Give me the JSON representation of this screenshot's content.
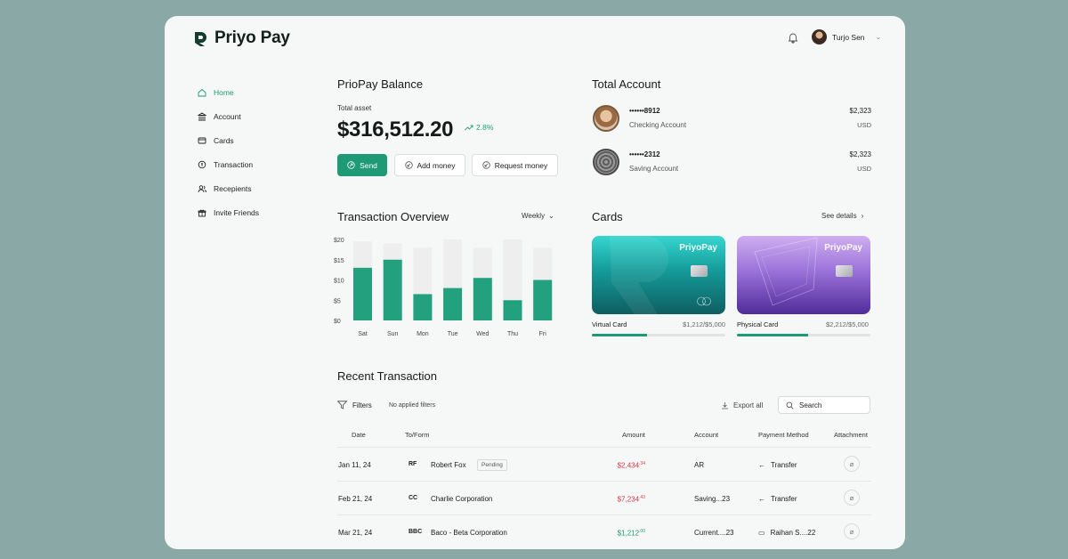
{
  "app": {
    "brand": "Priyo Pay",
    "user_name": "Turjo Sen"
  },
  "sidebar": {
    "items": [
      {
        "label": "Home",
        "icon": "home-icon",
        "active": true
      },
      {
        "label": "Account",
        "icon": "bank-icon"
      },
      {
        "label": "Cards",
        "icon": "card-icon"
      },
      {
        "label": "Transaction",
        "icon": "transaction-icon"
      },
      {
        "label": "Recepients",
        "icon": "recipients-icon"
      },
      {
        "label": "Invite Friends",
        "icon": "gift-icon"
      }
    ]
  },
  "balance": {
    "title": "PrioPay Balance",
    "total_label": "Total asset",
    "amount": "$316,512.20",
    "change": "2.8%",
    "send_label": "Send",
    "add_label": "Add money",
    "request_label": "Request money"
  },
  "accounts": {
    "title": "Total Account",
    "items": [
      {
        "number": "••••••8912",
        "type": "Checking Account",
        "amount": "$2,323",
        "currency": "USD"
      },
      {
        "number": "••••••2312",
        "type": "Saving Account",
        "amount": "$2,323",
        "currency": "USD"
      }
    ]
  },
  "overview": {
    "title": "Transaction Overview",
    "period": "Weekly"
  },
  "chart_data": {
    "type": "bar",
    "categories": [
      "Sat",
      "Sun",
      "Mon",
      "Tue",
      "Wed",
      "Thu",
      "Fri"
    ],
    "series": [
      {
        "values": [
          13,
          15,
          6.5,
          8,
          10.5,
          5,
          10
        ]
      },
      {
        "values": [
          19.5,
          19,
          18,
          20,
          18,
          20,
          18
        ]
      }
    ],
    "ylim": [
      0,
      20
    ],
    "y_ticks": [
      "$0",
      "$5",
      "$10",
      "$15",
      "$20"
    ],
    "colors": {
      "filled": "#23a07e",
      "track": "#eeeeee"
    }
  },
  "cards": {
    "title": "Cards",
    "see_details": "See details",
    "items": [
      {
        "brand": "PriyoPay",
        "label": "Virtual Card",
        "limit": "$1,212/$5,000",
        "progress": 0.41
      },
      {
        "brand": "PriyoPay",
        "label": "Physical Card",
        "limit": "$2,212/$5,000",
        "progress": 0.53
      }
    ]
  },
  "transactions": {
    "title": "Recent Transaction",
    "filters_label": "Filters",
    "no_filters": "No applied filters",
    "export_label": "Export all",
    "search_placeholder": "Search",
    "columns": [
      "Date",
      "To/Form",
      "Amount",
      "Account",
      "Payment Method",
      "Attachment"
    ],
    "rows": [
      {
        "date": "Jan 11, 24",
        "initials": "RF",
        "name": "Robert Fox",
        "badge": "Pending",
        "amount_main": "$2,434",
        "amount_cents": ".34",
        "sign": "neg",
        "account": "AR",
        "method": "Transfer",
        "method_icon": "arrow-left-icon"
      },
      {
        "date": "Feb 21, 24",
        "initials": "CC",
        "name": "Charlie Corporation",
        "badge": "",
        "amount_main": "$7,234",
        "amount_cents": ".43",
        "sign": "neg",
        "account": "Saving...23",
        "method": "Transfer",
        "method_icon": "arrow-left-icon"
      },
      {
        "date": "Mar 21, 24",
        "initials": "BBC",
        "name": "Baco - Beta Corporation",
        "badge": "",
        "amount_main": "$1,212",
        "amount_cents": ".00",
        "sign": "pos",
        "account": "Current....23",
        "method": "Raihan S....22",
        "method_icon": "card-icon"
      }
    ]
  },
  "colors": {
    "accent": "#1f9a76",
    "negative": "#d23b4a",
    "background": "#8aa8a6"
  }
}
